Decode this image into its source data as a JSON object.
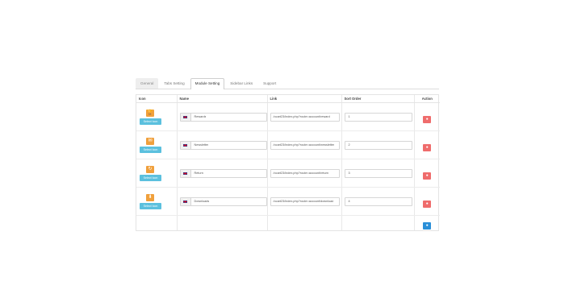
{
  "tabs": [
    {
      "label": "General"
    },
    {
      "label": "Tabs Setting"
    },
    {
      "label": "Module Setting"
    },
    {
      "label": "Sidebar Links"
    },
    {
      "label": "Support"
    }
  ],
  "table": {
    "headers": {
      "icon": "Icon",
      "name": "Name",
      "link": "Link",
      "sort_order": "Sort Order",
      "action": "Action"
    },
    "select_icon_label": "Select Icon",
    "rows": [
      {
        "icon": "trophy-icon",
        "glyph": "🏆",
        "name": "Rewards",
        "link": "/ocart23/index.php?route=account/reward",
        "sort_order": "1"
      },
      {
        "icon": "envelope-icon",
        "glyph": "✉",
        "name": "Newsletter",
        "link": "/ocart23/index.php?route=account/newsletter",
        "sort_order": "2"
      },
      {
        "icon": "refresh-icon",
        "glyph": "↻",
        "name": "Return",
        "link": "/ocart23/index.php?route=account/return",
        "sort_order": "3"
      },
      {
        "icon": "download-icon",
        "glyph": "⬇",
        "name": "Downloads",
        "link": "/ocart23/index.php?route=account/download",
        "sort_order": "4"
      }
    ]
  },
  "colors": {
    "icon_bg": "#f0a03c",
    "select_btn": "#5bc0de",
    "delete_btn": "#ef6c6c",
    "add_btn": "#2a8fd8"
  }
}
